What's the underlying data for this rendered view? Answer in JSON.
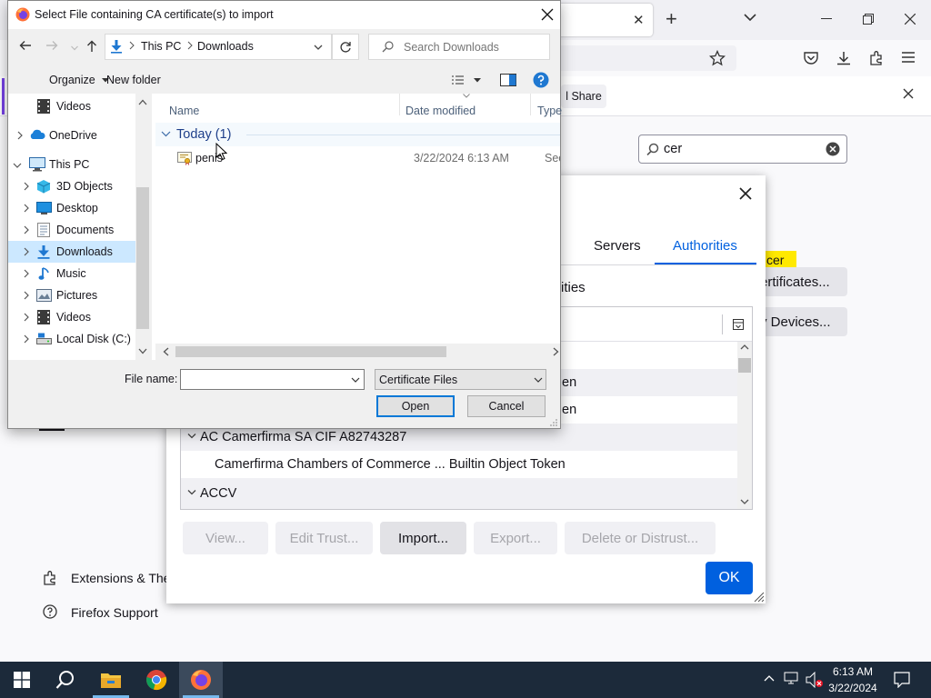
{
  "firefox": {
    "tab_close": "✕",
    "new_tab": "+",
    "notice_text": "l Share",
    "prefs": {
      "search_value": "cer",
      "highlight_word": "cer",
      "view_certificates_label": "ertificates...",
      "security_devices_label": "y Devices...",
      "sidebar_extensions": "Extensions & The",
      "sidebar_support": "Firefox Support"
    }
  },
  "cert_manager": {
    "tabs": [
      "Servers",
      "Authorities"
    ],
    "active_tab": "Authorities",
    "description_fragment": "ities",
    "rows": [
      {
        "text": "en",
        "type": "token-fragment"
      },
      {
        "text": "en",
        "type": "token-fragment"
      },
      {
        "text": "AC Camerfirma SA CIF A82743287",
        "type": "group"
      },
      {
        "text": "Camerfirma Chambers of Commerce ... Builtin Object Token",
        "type": "child"
      },
      {
        "text": "ACCV",
        "type": "group"
      }
    ],
    "buttons": {
      "view": "View...",
      "edit_trust": "Edit Trust...",
      "import": "Import...",
      "export": "Export...",
      "delete": "Delete or Distrust...",
      "ok": "OK"
    }
  },
  "file_dialog": {
    "title": "Select File containing CA certificate(s) to import",
    "breadcrumb": [
      "This PC",
      "Downloads"
    ],
    "search_placeholder": "Search Downloads",
    "organize": "Organize",
    "new_folder": "New folder",
    "nav_items": [
      {
        "label": "Videos",
        "icon": "video-folder-icon",
        "level": 1
      },
      {
        "label": "OneDrive",
        "icon": "onedrive-icon",
        "level": 0
      },
      {
        "label": "This PC",
        "icon": "computer-icon",
        "level": 0
      },
      {
        "label": "3D Objects",
        "icon": "cube-folder-icon",
        "level": 1
      },
      {
        "label": "Desktop",
        "icon": "desktop-folder-icon",
        "level": 1
      },
      {
        "label": "Documents",
        "icon": "documents-folder-icon",
        "level": 1
      },
      {
        "label": "Downloads",
        "icon": "downloads-folder-icon",
        "level": 1,
        "selected": true
      },
      {
        "label": "Music",
        "icon": "music-folder-icon",
        "level": 1
      },
      {
        "label": "Pictures",
        "icon": "pictures-folder-icon",
        "level": 1
      },
      {
        "label": "Videos",
        "icon": "video-folder-icon",
        "level": 1
      },
      {
        "label": "Local Disk (C:)",
        "icon": "drive-icon",
        "level": 1
      }
    ],
    "columns": [
      "Name",
      "Date modified",
      "Type"
    ],
    "group_header": "Today (1)",
    "files": [
      {
        "name": "penis",
        "date": "3/22/2024 6:13 AM",
        "type": "Secu"
      }
    ],
    "file_name_label": "File name:",
    "file_name_value": "",
    "file_type_value": "Certificate Files",
    "open": "Open",
    "cancel": "Cancel"
  },
  "taskbar": {
    "time": "6:13 AM",
    "date": "3/22/2024",
    "apps": [
      "start-button",
      "search",
      "file-explorer",
      "chrome",
      "firefox"
    ]
  },
  "colors": {
    "accent_blue": "#0060df",
    "win_selection": "#cce8ff",
    "taskbar": "#1c2a3a",
    "highlight_yellow": "#ffe900"
  }
}
